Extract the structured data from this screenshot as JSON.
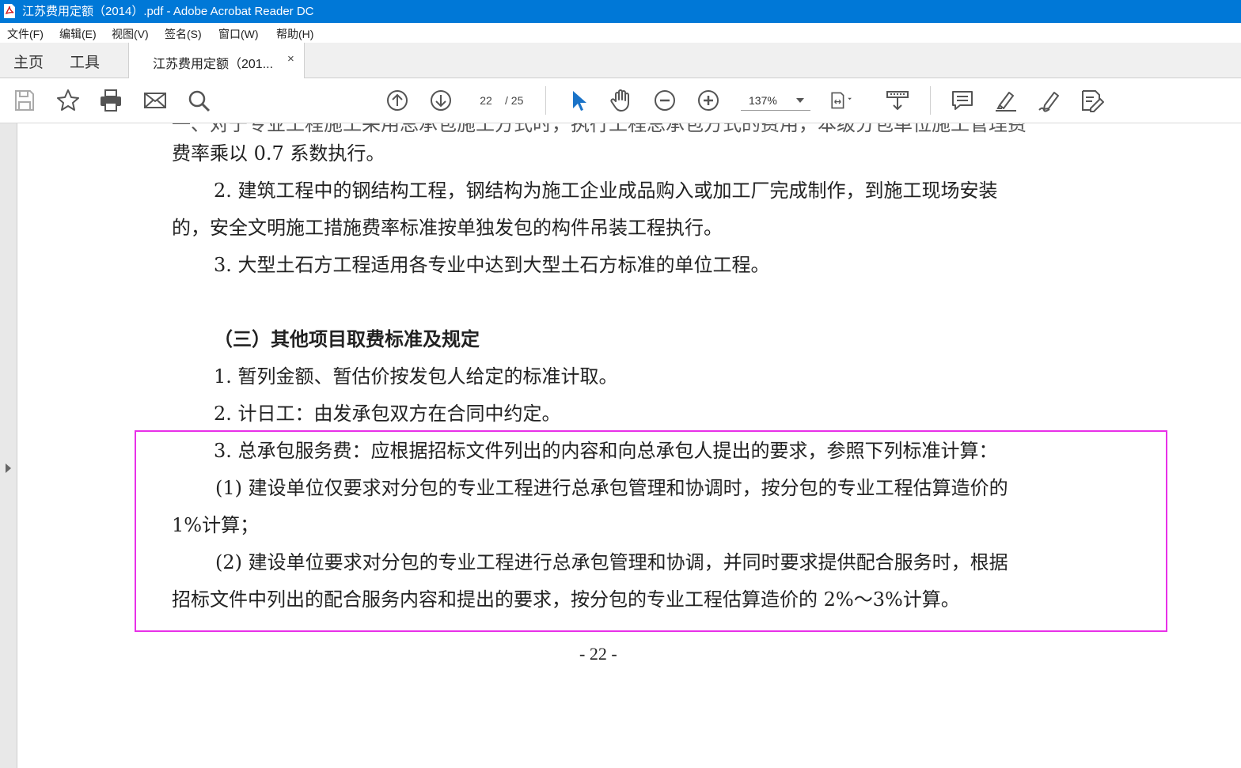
{
  "window": {
    "title": "江苏费用定额（2014）.pdf - Adobe Acrobat Reader DC"
  },
  "menu": {
    "items": [
      "文件(F)",
      "编辑(E)",
      "视图(V)",
      "签名(S)",
      "窗口(W)",
      "帮助(H)"
    ]
  },
  "tabs": {
    "home": "主页",
    "tools": "工具",
    "document": "江苏费用定额（201...",
    "close": "×"
  },
  "toolbar": {
    "page_current": "22",
    "page_total": "/ 25",
    "zoom": "137%"
  },
  "document": {
    "top_partial_line": "一、对于专业工程施工采用总承包施工方式时，执行工程总承包方式的费用，本级分包单位施工管理费",
    "lines": [
      "费率乘以 0.7 系数执行。",
      "2. 建筑工程中的钢结构工程，钢结构为施工企业成品购入或加工厂完成制作，到施工现场安装",
      "的，安全文明施工措施费率标准按单独发包的构件吊装工程执行。",
      "3. 大型土石方工程适用各专业中达到大型土石方标准的单位工程。",
      "（三）其他项目取费标准及规定",
      "1. 暂列金额、暂估价按发包人给定的标准计取。",
      "2. 计日工：由发承包双方在合同中约定。",
      "3. 总承包服务费：应根据招标文件列出的内容和向总承包人提出的要求，参照下列标准计算：",
      "(1) 建设单位仅要求对分包的专业工程进行总承包管理和协调时，按分包的专业工程估算造价的",
      "1%计算；",
      "(2) 建设单位要求对分包的专业工程进行总承包管理和协调，并同时要求提供配合服务时，根据",
      "招标文件中列出的配合服务内容和提出的要求，按分包的专业工程估算造价的 2%～3%计算。"
    ],
    "page_number": "- 22 -"
  },
  "colors": {
    "titlebar": "#0078d7",
    "highlight_border": "#e830e8",
    "icon": "#555555",
    "select_icon": "#1a73c8"
  }
}
